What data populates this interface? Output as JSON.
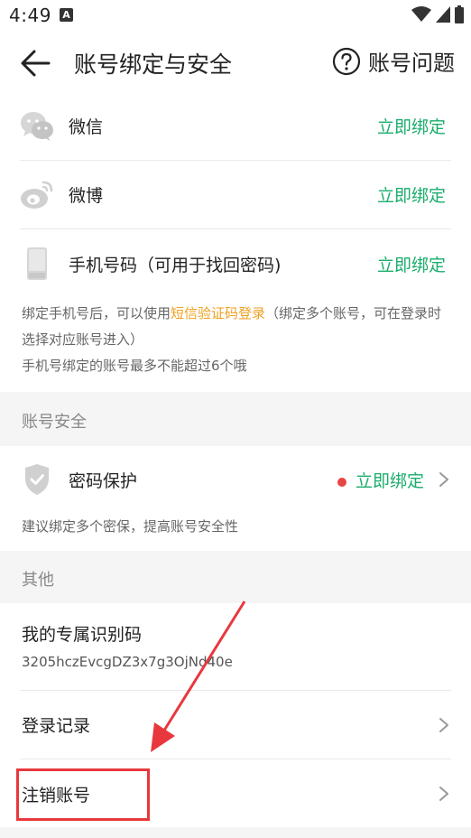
{
  "status": {
    "time": "4:49",
    "a_icon_letter": "A"
  },
  "header": {
    "title": "账号绑定与安全",
    "help_label": "账号问题"
  },
  "bindings": [
    {
      "icon": "wechat-icon",
      "label": "微信",
      "action": "立即绑定"
    },
    {
      "icon": "weibo-icon",
      "label": "微博",
      "action": "立即绑定"
    },
    {
      "icon": "phone-icon",
      "label": "手机号码（可用于找回密码)",
      "action": "立即绑定"
    }
  ],
  "binding_note": {
    "prefix": "绑定手机号后，可以使用",
    "highlight": "短信验证码登录",
    "suffix": "（绑定多个账号，可在登录时选择对应账号进入）",
    "line2": "手机号绑定的账号最多不能超过6个哦"
  },
  "security": {
    "section_title": "账号安全",
    "label": "密码保护",
    "action": "立即绑定",
    "note": "建议绑定多个密保，提高账号安全性"
  },
  "other": {
    "section_title": "其他",
    "code_title": "我的专属识别码",
    "code_value": "3205hczEvcgDZ3x7g3OjNd40e",
    "login_record": "登录记录",
    "cancel_account": "注销账号"
  },
  "colors": {
    "accent_green": "#1aad6b",
    "highlight_orange": "#f0a020",
    "alert_red": "#e84545",
    "annotation_red": "#e8383d"
  }
}
